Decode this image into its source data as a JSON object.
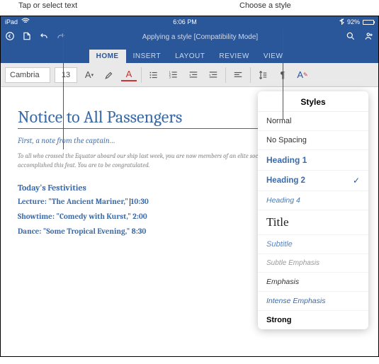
{
  "annotations": {
    "left": "Tap or select text",
    "right": "Choose a style"
  },
  "statusbar": {
    "device": "iPad",
    "wifi": "wifi",
    "time": "6:06 PM",
    "bt": "92%"
  },
  "titlebar": {
    "doc": "Applying a style [Compatibility Mode]"
  },
  "tabs": [
    "HOME",
    "INSERT",
    "LAYOUT",
    "REVIEW",
    "VIEW"
  ],
  "ribbon": {
    "font": "Cambria",
    "size": "13"
  },
  "doc": {
    "title": "Notice to All Passengers",
    "subtitle": "First, a note from the captain…",
    "body": "To all who crossed the Equator aboard our ship last week, you are now members of an elite society. Only a few landlubbers have accomplished this feat. You are to be congratulated.",
    "h2": "Today's Festivities",
    "l1a": "Lecture: \"The Ancient Mariner,\" ",
    "l1b": "10:30",
    "l2": "Showtime: \"Comedy with Kurst,\" 2:00",
    "l3": "Dance: \"Some Tropical Evening,\" 8:30"
  },
  "popover": {
    "title": "Styles",
    "items": [
      {
        "label": "Normal",
        "cls": "s-normal"
      },
      {
        "label": "No Spacing",
        "cls": "s-normal"
      },
      {
        "label": "Heading 1",
        "cls": "s-h1"
      },
      {
        "label": "Heading 2",
        "cls": "s-h2",
        "selected": true
      },
      {
        "label": "Heading 4",
        "cls": "s-h4"
      },
      {
        "label": "Title",
        "cls": "s-title"
      },
      {
        "label": "Subtitle",
        "cls": "s-subtitle"
      },
      {
        "label": "Subtle Emphasis",
        "cls": "s-subtle"
      },
      {
        "label": "Emphasis",
        "cls": "s-emph"
      },
      {
        "label": "Intense Emphasis",
        "cls": "s-intense"
      },
      {
        "label": "Strong",
        "cls": "s-strong"
      }
    ]
  }
}
